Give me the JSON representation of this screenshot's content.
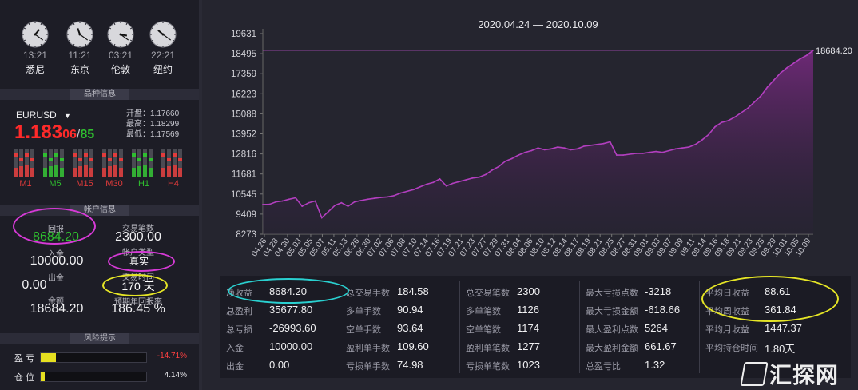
{
  "clocks": [
    {
      "time": "13:21",
      "city": "悉尼"
    },
    {
      "time": "11:21",
      "city": "东京"
    },
    {
      "time": "03:21",
      "city": "伦敦"
    },
    {
      "time": "22:21",
      "city": "纽约"
    }
  ],
  "symbol_section": {
    "header": "品种信息",
    "symbol": "EURUSD",
    "price_big": "1.183",
    "price_mid": "06",
    "price_slash": "/",
    "price_end": "85",
    "open_label": "开盘：",
    "open_value": "1.17660",
    "high_label": "最高：",
    "high_value": "1.18299",
    "low_label": "最低：",
    "low_value": "1.17569",
    "timeframes": [
      "M1",
      "M5",
      "M15",
      "M30",
      "H1",
      "H4"
    ],
    "timeframe_colors": [
      "#e23b3b",
      "#2fbf2f",
      "#e23b3b",
      "#e23b3b",
      "#2fbf2f",
      "#e23b3b"
    ]
  },
  "account_section": {
    "header": "帐户信息",
    "return_label": "回报",
    "return_value": "8684.20",
    "trades_label": "交易笔数",
    "trades_value": "2300.00",
    "deposit_label": "入金",
    "deposit_value": "10000.00",
    "account_type_label": "帐户类型",
    "account_type_value": "真实",
    "withdraw_label": "出金",
    "withdraw_value": "0.00",
    "duration_label": "交易时间",
    "duration_value": "170 天",
    "balance_label": "余额",
    "balance_value": "18684.20",
    "annual_label": "预期年回报率",
    "annual_value": "186.45 %"
  },
  "risk_section": {
    "header": "风险提示",
    "pl_label": "盈 亏",
    "pl_value": "-14.71%",
    "pl_fraction": 0.1471,
    "pos_label": "仓 位",
    "pos_value": "4.14%",
    "pos_fraction": 0.0414
  },
  "chart_data": {
    "type": "area",
    "title": "2020.04.24 — 2020.10.09",
    "y_ticks": [
      19631,
      18495,
      17359,
      16223,
      15088,
      13952,
      12816,
      11681,
      10545,
      9409,
      8273
    ],
    "ylim": [
      8273,
      19631
    ],
    "x_ticks": [
      "04.26",
      "04.28",
      "04.30",
      "05.03",
      "05.05",
      "05.07",
      "05.11",
      "05.13",
      "06.26",
      "06.30",
      "07.02",
      "07.06",
      "07.08",
      "07.10",
      "07.14",
      "07.16",
      "07.19",
      "07.21",
      "07.23",
      "07.27",
      "07.29",
      "07.31",
      "08.04",
      "08.06",
      "08.10",
      "08.12",
      "08.14",
      "08.17",
      "08.19",
      "08.21",
      "08.25",
      "08.27",
      "08.31",
      "09.01",
      "09.03",
      "09.07",
      "09.09",
      "09.11",
      "09.14",
      "09.16",
      "09.18",
      "09.21",
      "09.23",
      "09.25",
      "09.29",
      "10.01",
      "10.05",
      "10.09"
    ],
    "last_value_label": "18684.20",
    "reference_line": 18684.2,
    "values": [
      9950,
      9960,
      10100,
      10150,
      10250,
      10330,
      9850,
      10050,
      10150,
      9200,
      9550,
      9900,
      10050,
      9850,
      10100,
      10180,
      10250,
      10300,
      10350,
      10380,
      10450,
      10600,
      10700,
      10800,
      10950,
      11100,
      11200,
      11400,
      11000,
      11150,
      11250,
      11350,
      11450,
      11500,
      11650,
      11900,
      12100,
      12400,
      12550,
      12750,
      12900,
      13000,
      13150,
      13050,
      13100,
      13200,
      13150,
      13050,
      13100,
      13250,
      13300,
      13350,
      13400,
      13500,
      12750,
      12750,
      12800,
      12850,
      12850,
      12900,
      12950,
      12900,
      13000,
      13100,
      13150,
      13200,
      13350,
      13600,
      13900,
      14350,
      14600,
      14700,
      14900,
      15150,
      15400,
      15750,
      16100,
      16600,
      17000,
      17400,
      17700,
      17950,
      18200,
      18400,
      18684.2
    ],
    "color": "#b23fbf"
  },
  "stats": {
    "col1": [
      {
        "label": "净收益",
        "value": "8684.20"
      },
      {
        "label": "总盈利",
        "value": "35677.80"
      },
      {
        "label": "总亏损",
        "value": "-26993.60"
      },
      {
        "label": "入金",
        "value": "10000.00"
      },
      {
        "label": "出金",
        "value": "0.00"
      }
    ],
    "col2": [
      {
        "label": "总交易手数",
        "value": "184.58"
      },
      {
        "label": "多单手数",
        "value": "90.94"
      },
      {
        "label": "空单手数",
        "value": "93.64"
      },
      {
        "label": "盈利单手数",
        "value": "109.60"
      },
      {
        "label": "亏损单手数",
        "value": "74.98"
      }
    ],
    "col3": [
      {
        "label": "总交易笔数",
        "value": "2300"
      },
      {
        "label": "多单笔数",
        "value": "1126"
      },
      {
        "label": "空单笔数",
        "value": "1174"
      },
      {
        "label": "盈利单笔数",
        "value": "1277"
      },
      {
        "label": "亏损单笔数",
        "value": "1023"
      }
    ],
    "col4": [
      {
        "label": "最大亏损点数",
        "value": "-3218"
      },
      {
        "label": "最大亏损金额",
        "value": "-618.66"
      },
      {
        "label": "最大盈利点数",
        "value": "5264"
      },
      {
        "label": "最大盈利金额",
        "value": "661.67"
      },
      {
        "label": "总盈亏比",
        "value": "1.32"
      }
    ],
    "col5": [
      {
        "label": "平均日收益",
        "value": "88.61"
      },
      {
        "label": "平均周收益",
        "value": "361.84"
      },
      {
        "label": "平均月收益",
        "value": "1447.37"
      },
      {
        "label": "平均持仓时间",
        "value": "1.80天"
      }
    ]
  },
  "watermark": "汇探网"
}
